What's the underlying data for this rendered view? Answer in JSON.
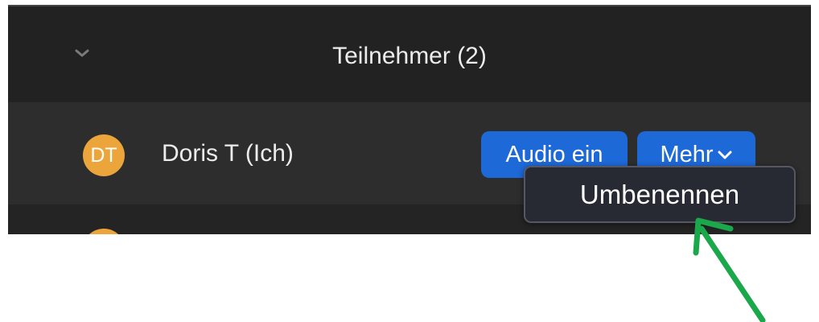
{
  "panel": {
    "title": "Teilnehmer (2)",
    "collapse_icon": "chevron-down-icon"
  },
  "participant": {
    "initials": "DT",
    "name": "Doris T (Ich)",
    "avatar_color": "#eba53a"
  },
  "actions": {
    "audio_label": "Audio ein",
    "more_label": "Mehr",
    "more_icon": "chevron-down-icon",
    "button_color": "#1d69d8"
  },
  "menu": {
    "items": [
      {
        "label": "Umbenennen"
      }
    ]
  },
  "annotation": {
    "icon": "arrow-icon",
    "color": "#1aa84a"
  }
}
